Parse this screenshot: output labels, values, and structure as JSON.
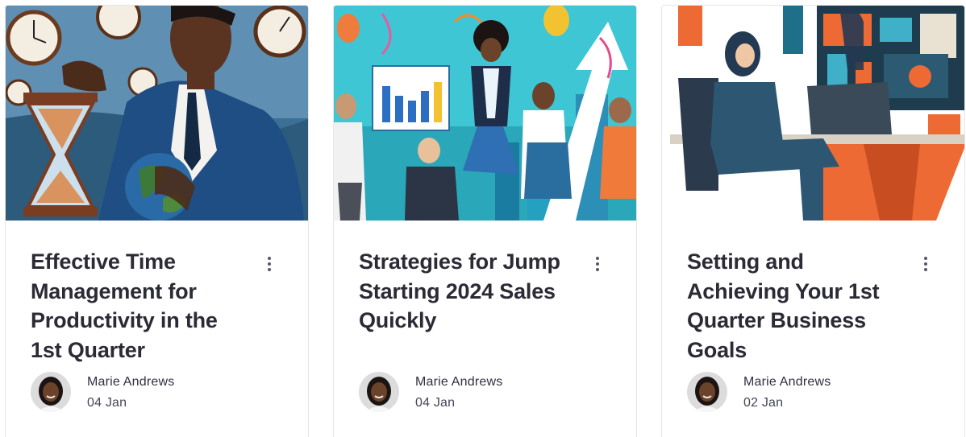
{
  "cards": [
    {
      "title": "Effective Time Management for Productivity in the 1st Quarter",
      "author": "Marie Andrews",
      "date": "04 Jan",
      "image_icon": "businessman-hourglass-illustration"
    },
    {
      "title": "Strategies for Jump Starting 2024 Sales Quickly",
      "author": "Marie Andrews",
      "date": "04 Jan",
      "image_icon": "celebrating-team-chart-illustration"
    },
    {
      "title": "Setting and Achieving Your 1st Quarter Business Goals",
      "author": "Marie Andrews",
      "date": "02 Jan",
      "image_icon": "businesswoman-office-illustration"
    }
  ],
  "menu_icon": "more-vertical-icon",
  "colors": {
    "title": "#2b2b36",
    "meta": "#444656",
    "card_border": "#e6e6e6"
  }
}
